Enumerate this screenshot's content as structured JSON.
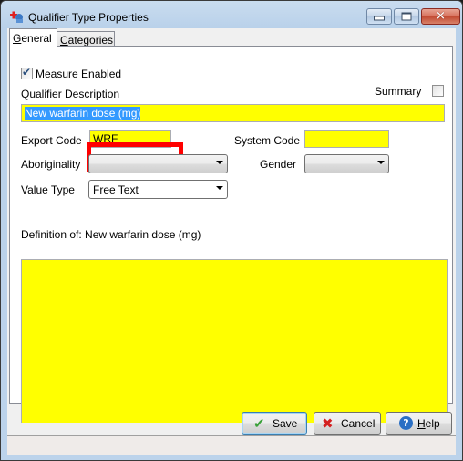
{
  "window": {
    "title": "Qualifier Type Properties",
    "icon": "qualifier-app-icon",
    "controls": {
      "minimize": "minimize-icon",
      "maximize": "maximize-icon",
      "close": "close-icon",
      "close_glyph": "✕"
    }
  },
  "tabs": [
    {
      "label": "General",
      "mnemonic": "G",
      "rest": "eneral",
      "active": true
    },
    {
      "label": "Categories",
      "mnemonic": "C",
      "rest": "ategories",
      "active": false
    }
  ],
  "form": {
    "measure_enabled": {
      "label": "Measure Enabled",
      "checked": true,
      "tick": "✔"
    },
    "qualifier_description": {
      "label": "Qualifier Description",
      "value": "New warfarin dose (mg)"
    },
    "summary": {
      "label": "Summary",
      "checked": false
    },
    "export_code": {
      "label": "Export Code",
      "value": "WRF"
    },
    "system_code": {
      "label": "System Code",
      "value": ""
    },
    "aboriginality": {
      "label": "Aboriginality",
      "value": ""
    },
    "gender": {
      "label": "Gender",
      "value": ""
    },
    "value_type": {
      "label": "Value Type",
      "value": "Free Text"
    },
    "definition": {
      "label": "Definition of: New warfarin dose (mg)",
      "value": ""
    }
  },
  "buttons": {
    "save": {
      "label": "Save",
      "icon": "✔"
    },
    "cancel": {
      "label": "Cancel",
      "icon": "✖"
    },
    "help": {
      "label": "Help",
      "mnemonic": "H",
      "rest": "elp",
      "icon": "?"
    }
  },
  "colors": {
    "field_highlight": "#ffff00",
    "annotation_box": "#ff0000",
    "selection": "#3399ff"
  }
}
